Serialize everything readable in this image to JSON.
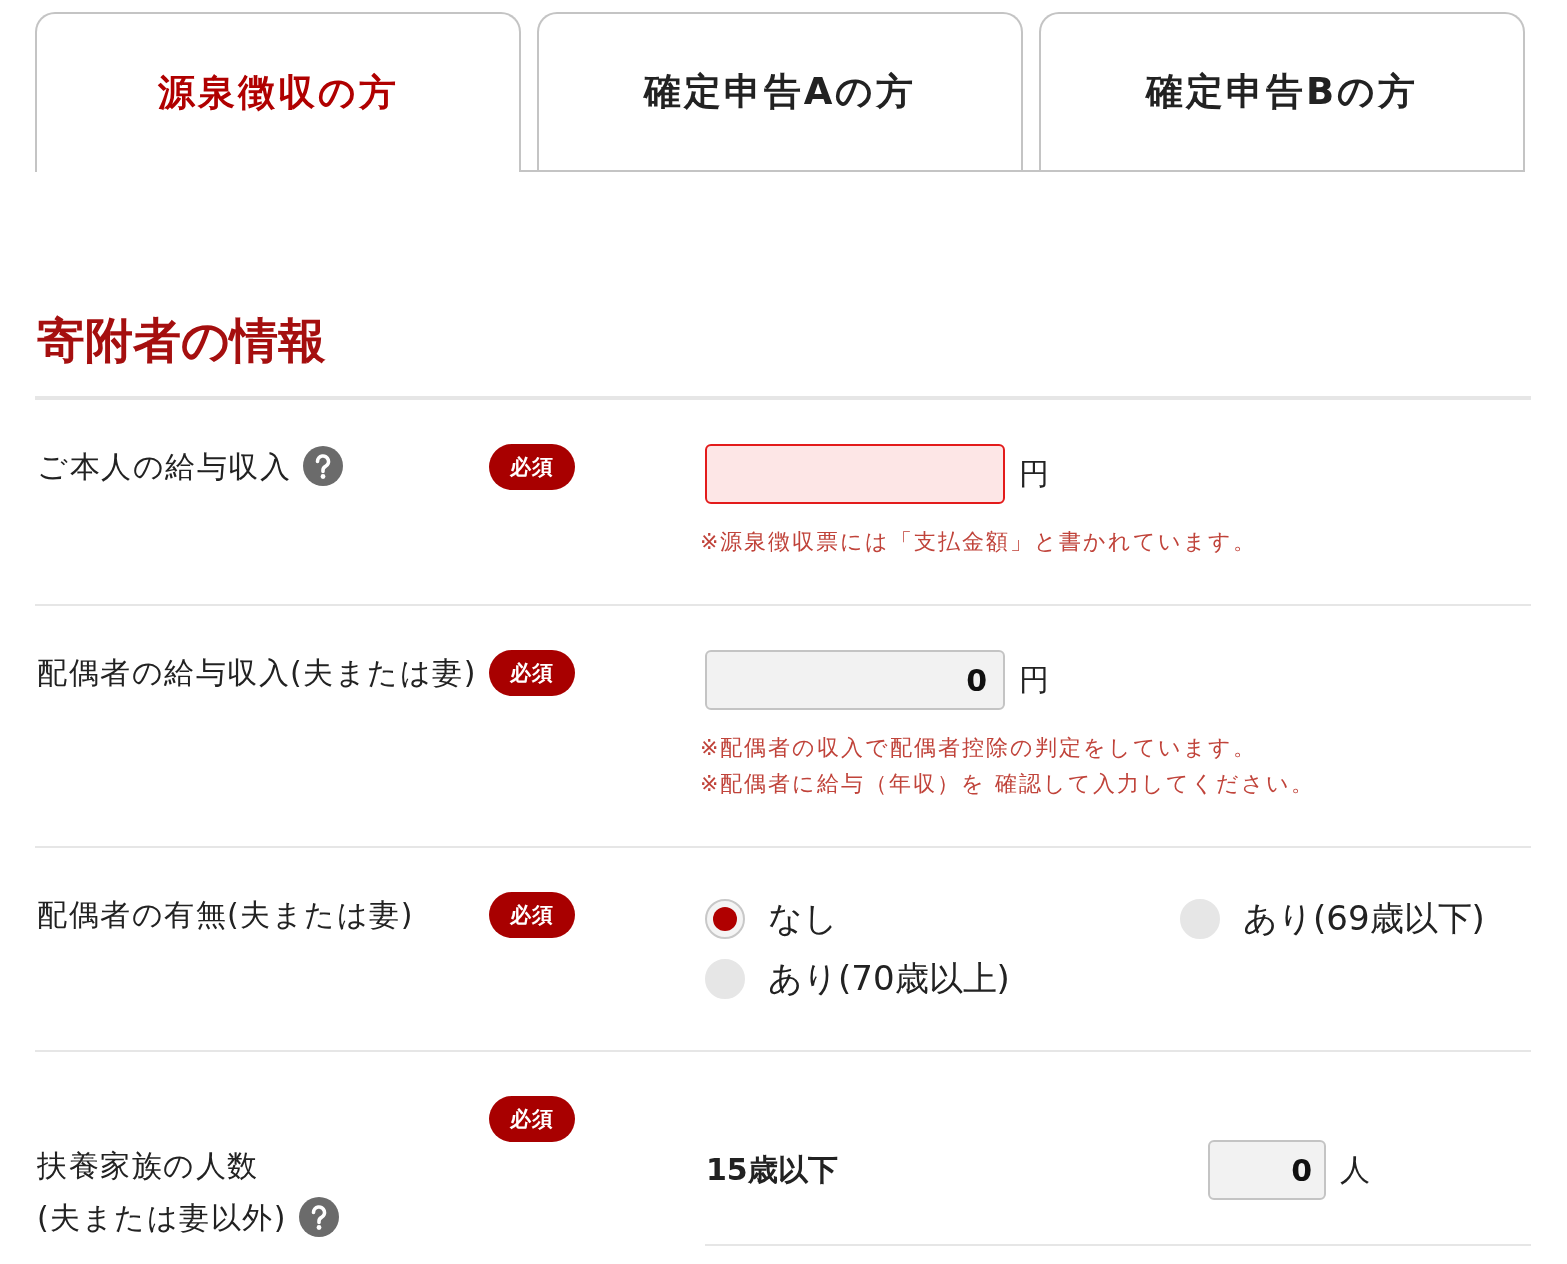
{
  "tabs": [
    {
      "label": "源泉徴収の方",
      "selected": true
    },
    {
      "label": "確定申告Aの方",
      "selected": false
    },
    {
      "label": "確定申告Bの方",
      "selected": false
    }
  ],
  "section": {
    "title": "寄附者の情報"
  },
  "rows": [
    {
      "kind": "amount",
      "label_lines": [
        "ご本人の給与収入"
      ],
      "help": true,
      "required_badge": "必須",
      "field": {
        "error": true
      },
      "unit": "円",
      "notes": [
        "※源泉徴収票には「支払金額」と書かれています。"
      ]
    },
    {
      "kind": "amount",
      "label_lines": [
        "配偶者の給与収入(夫または妻)"
      ],
      "help": false,
      "required_badge": "必須",
      "field": {
        "value": "0",
        "error": false
      },
      "unit": "円",
      "notes": [
        "※配偶者の収入で配偶者控除の判定をしています。",
        "※配偶者に給与（年収）を 確認して入力してください。"
      ]
    },
    {
      "kind": "radio",
      "label_lines": [
        "配偶者の有無(夫または妻)"
      ],
      "help": false,
      "required_badge": "必須",
      "options": [
        {
          "label": "なし",
          "selected": true
        },
        {
          "label": "あり(69歳以下)",
          "selected": false
        },
        {
          "label": "あり(70歳以上)",
          "selected": false
        }
      ]
    },
    {
      "kind": "count",
      "label_lines": [
        "扶養家族の人数",
        "(夫または妻以外)"
      ],
      "help": true,
      "required_badge": "必須",
      "entries": [
        {
          "label": "15歳以下",
          "value": "0",
          "unit": "人"
        }
      ]
    }
  ]
}
